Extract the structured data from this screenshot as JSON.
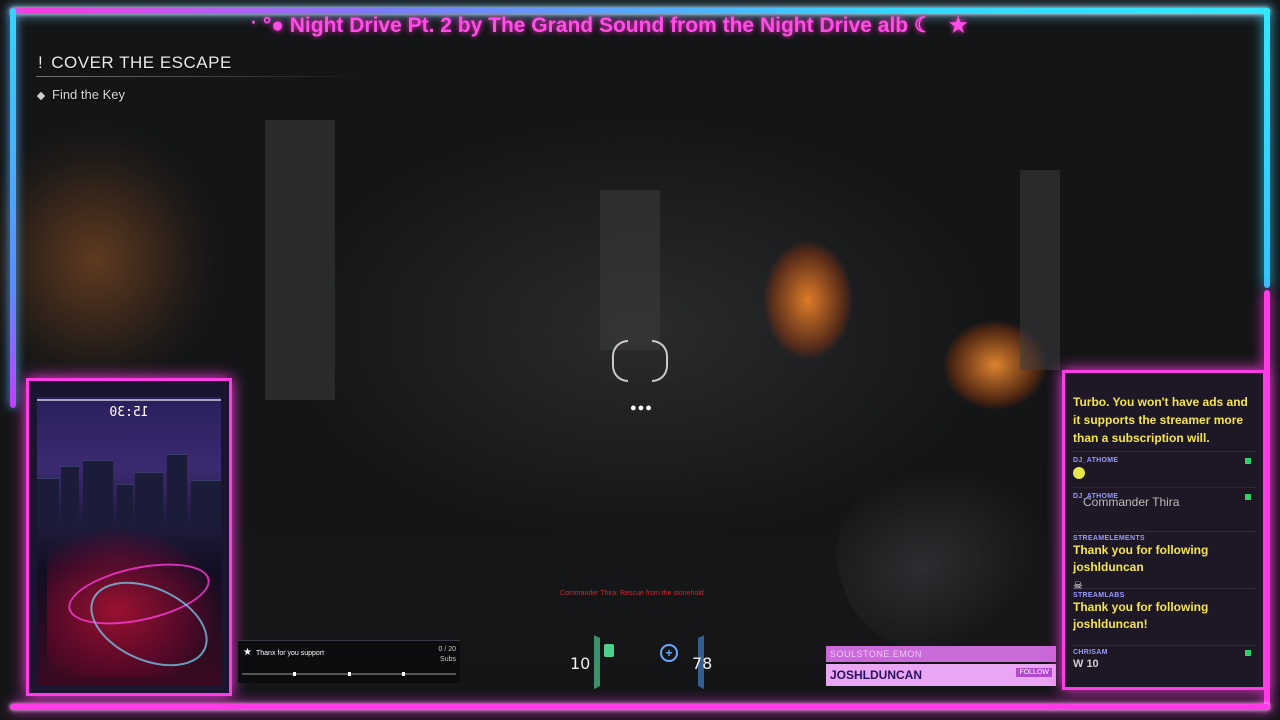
{
  "ticker": {
    "text": "ˑ °● Night Drive Pt. 2 by The Grand Sound from the Night Drive alb ☾",
    "star": "★"
  },
  "objective": {
    "title_icon": "!",
    "title": "COVER THE ESCAPE",
    "task": "Find the Key"
  },
  "crosshair": {
    "ammo_pips": "●●●"
  },
  "webcam": {
    "clock": "15:30"
  },
  "sub_goal": {
    "label": "Thanx for you support",
    "count": "0 / 20",
    "unit": "Subs",
    "progress": 0.0
  },
  "hud": {
    "warning": "Commander Thira: Rescue from the stonehold",
    "left_value": "10",
    "right_value": "78"
  },
  "follower_alert": {
    "title": "SOULSTONE.EMON",
    "name": "JOSHLDUNCAN",
    "action": "FOLLOW"
  },
  "chat": {
    "banner": "Turbo. You won't have ads and it supports the streamer more than a subscription will.",
    "overlay_name": "Commander Thira",
    "messages": [
      {
        "user": "DJ_ATHOME",
        "text": ""
      },
      {
        "user": "DJ_ATHOME",
        "text": ""
      },
      {
        "user": "STREAMELEMENTS",
        "text": "Thank you for following joshlduncan"
      },
      {
        "user": "STREAMLABS",
        "text": "Thank you for following joshlduncan!"
      },
      {
        "user": "CHRISAM",
        "text": "W 10"
      }
    ],
    "badge_color": "#2ed36a",
    "text_color": "#f6e64a"
  },
  "colors": {
    "neon_pink": "#ff3ce6",
    "neon_cyan": "#33d6ff"
  }
}
